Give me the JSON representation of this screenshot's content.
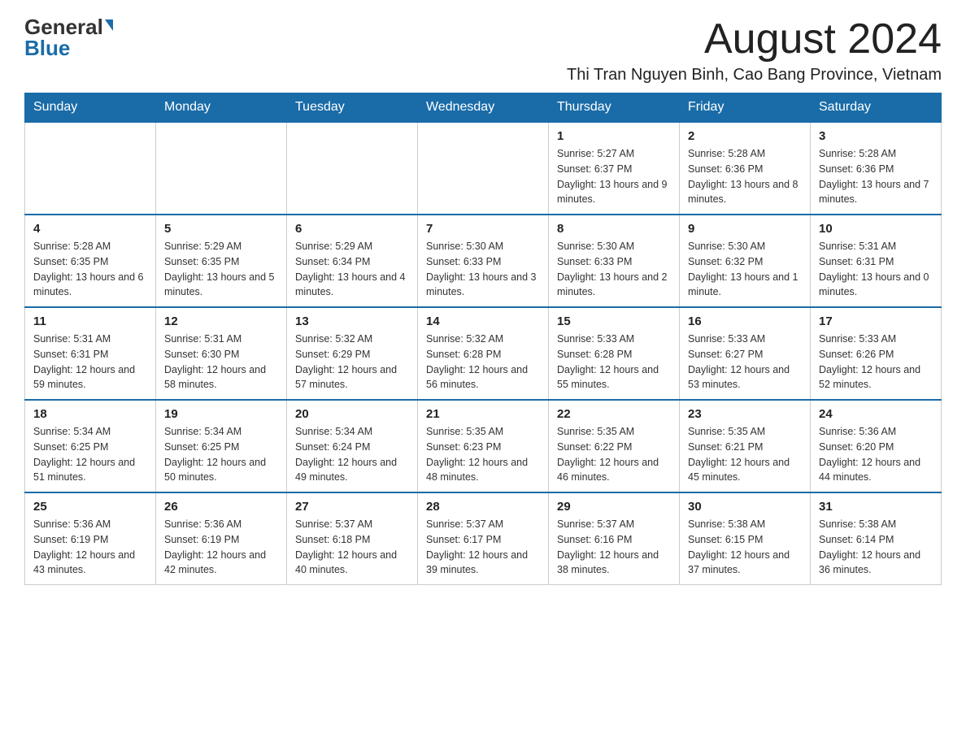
{
  "logo": {
    "general": "General",
    "blue": "Blue"
  },
  "header": {
    "month_title": "August 2024",
    "location": "Thi Tran Nguyen Binh, Cao Bang Province, Vietnam"
  },
  "days_of_week": [
    "Sunday",
    "Monday",
    "Tuesday",
    "Wednesday",
    "Thursday",
    "Friday",
    "Saturday"
  ],
  "weeks": [
    [
      {
        "day": "",
        "info": ""
      },
      {
        "day": "",
        "info": ""
      },
      {
        "day": "",
        "info": ""
      },
      {
        "day": "",
        "info": ""
      },
      {
        "day": "1",
        "info": "Sunrise: 5:27 AM\nSunset: 6:37 PM\nDaylight: 13 hours and 9 minutes."
      },
      {
        "day": "2",
        "info": "Sunrise: 5:28 AM\nSunset: 6:36 PM\nDaylight: 13 hours and 8 minutes."
      },
      {
        "day": "3",
        "info": "Sunrise: 5:28 AM\nSunset: 6:36 PM\nDaylight: 13 hours and 7 minutes."
      }
    ],
    [
      {
        "day": "4",
        "info": "Sunrise: 5:28 AM\nSunset: 6:35 PM\nDaylight: 13 hours and 6 minutes."
      },
      {
        "day": "5",
        "info": "Sunrise: 5:29 AM\nSunset: 6:35 PM\nDaylight: 13 hours and 5 minutes."
      },
      {
        "day": "6",
        "info": "Sunrise: 5:29 AM\nSunset: 6:34 PM\nDaylight: 13 hours and 4 minutes."
      },
      {
        "day": "7",
        "info": "Sunrise: 5:30 AM\nSunset: 6:33 PM\nDaylight: 13 hours and 3 minutes."
      },
      {
        "day": "8",
        "info": "Sunrise: 5:30 AM\nSunset: 6:33 PM\nDaylight: 13 hours and 2 minutes."
      },
      {
        "day": "9",
        "info": "Sunrise: 5:30 AM\nSunset: 6:32 PM\nDaylight: 13 hours and 1 minute."
      },
      {
        "day": "10",
        "info": "Sunrise: 5:31 AM\nSunset: 6:31 PM\nDaylight: 13 hours and 0 minutes."
      }
    ],
    [
      {
        "day": "11",
        "info": "Sunrise: 5:31 AM\nSunset: 6:31 PM\nDaylight: 12 hours and 59 minutes."
      },
      {
        "day": "12",
        "info": "Sunrise: 5:31 AM\nSunset: 6:30 PM\nDaylight: 12 hours and 58 minutes."
      },
      {
        "day": "13",
        "info": "Sunrise: 5:32 AM\nSunset: 6:29 PM\nDaylight: 12 hours and 57 minutes."
      },
      {
        "day": "14",
        "info": "Sunrise: 5:32 AM\nSunset: 6:28 PM\nDaylight: 12 hours and 56 minutes."
      },
      {
        "day": "15",
        "info": "Sunrise: 5:33 AM\nSunset: 6:28 PM\nDaylight: 12 hours and 55 minutes."
      },
      {
        "day": "16",
        "info": "Sunrise: 5:33 AM\nSunset: 6:27 PM\nDaylight: 12 hours and 53 minutes."
      },
      {
        "day": "17",
        "info": "Sunrise: 5:33 AM\nSunset: 6:26 PM\nDaylight: 12 hours and 52 minutes."
      }
    ],
    [
      {
        "day": "18",
        "info": "Sunrise: 5:34 AM\nSunset: 6:25 PM\nDaylight: 12 hours and 51 minutes."
      },
      {
        "day": "19",
        "info": "Sunrise: 5:34 AM\nSunset: 6:25 PM\nDaylight: 12 hours and 50 minutes."
      },
      {
        "day": "20",
        "info": "Sunrise: 5:34 AM\nSunset: 6:24 PM\nDaylight: 12 hours and 49 minutes."
      },
      {
        "day": "21",
        "info": "Sunrise: 5:35 AM\nSunset: 6:23 PM\nDaylight: 12 hours and 48 minutes."
      },
      {
        "day": "22",
        "info": "Sunrise: 5:35 AM\nSunset: 6:22 PM\nDaylight: 12 hours and 46 minutes."
      },
      {
        "day": "23",
        "info": "Sunrise: 5:35 AM\nSunset: 6:21 PM\nDaylight: 12 hours and 45 minutes."
      },
      {
        "day": "24",
        "info": "Sunrise: 5:36 AM\nSunset: 6:20 PM\nDaylight: 12 hours and 44 minutes."
      }
    ],
    [
      {
        "day": "25",
        "info": "Sunrise: 5:36 AM\nSunset: 6:19 PM\nDaylight: 12 hours and 43 minutes."
      },
      {
        "day": "26",
        "info": "Sunrise: 5:36 AM\nSunset: 6:19 PM\nDaylight: 12 hours and 42 minutes."
      },
      {
        "day": "27",
        "info": "Sunrise: 5:37 AM\nSunset: 6:18 PM\nDaylight: 12 hours and 40 minutes."
      },
      {
        "day": "28",
        "info": "Sunrise: 5:37 AM\nSunset: 6:17 PM\nDaylight: 12 hours and 39 minutes."
      },
      {
        "day": "29",
        "info": "Sunrise: 5:37 AM\nSunset: 6:16 PM\nDaylight: 12 hours and 38 minutes."
      },
      {
        "day": "30",
        "info": "Sunrise: 5:38 AM\nSunset: 6:15 PM\nDaylight: 12 hours and 37 minutes."
      },
      {
        "day": "31",
        "info": "Sunrise: 5:38 AM\nSunset: 6:14 PM\nDaylight: 12 hours and 36 minutes."
      }
    ]
  ]
}
